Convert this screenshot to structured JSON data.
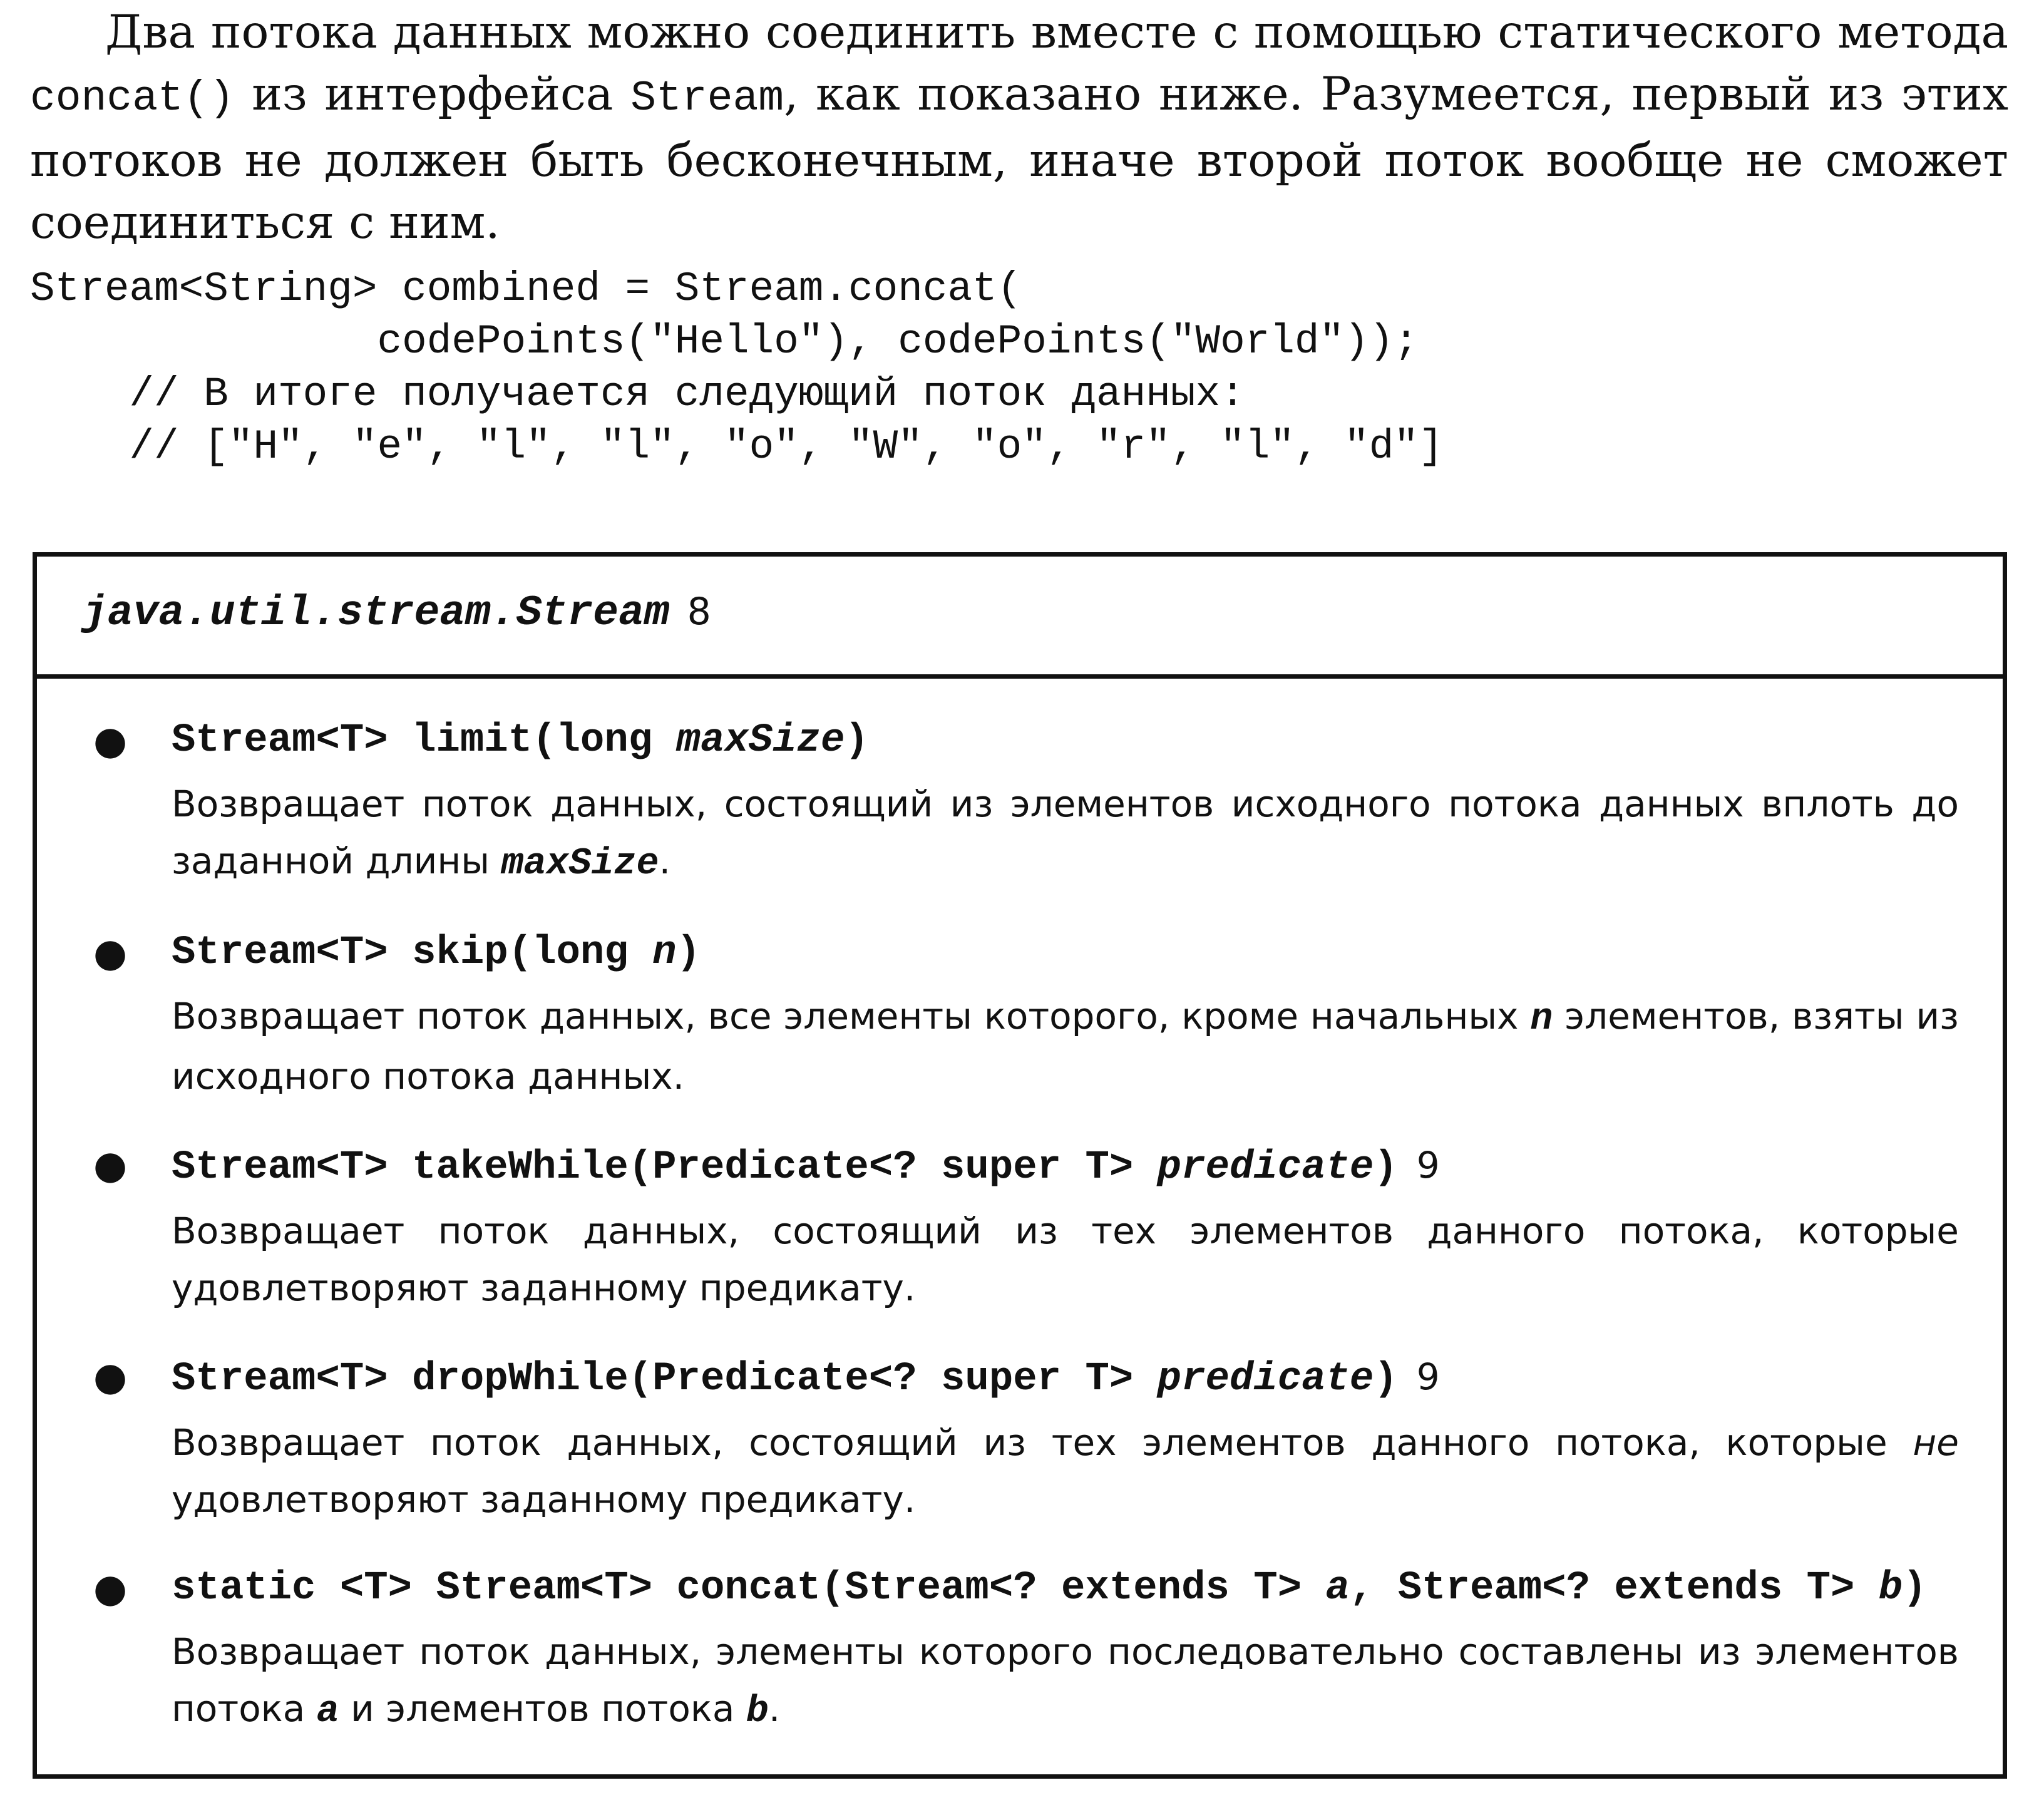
{
  "paragraph": {
    "part1": "Два потока данных можно соединить вместе с помощью статического метода ",
    "method_concat": "concat()",
    "part2": " из интерфейса ",
    "iface_stream": "Stream",
    "part3": ", как показано ниже. Разумеется, первый из этих потоков не должен быть бесконечным, иначе второй поток вообще не сможет соединиться с ним."
  },
  "code_lines": [
    "Stream<String> combined = Stream.concat(",
    "              codePoints(\"Hello\"), codePoints(\"World\"));",
    "    // В итоге получается следующий поток данных:",
    "    // [\"H\", \"e\", \"l\", \"l\", \"o\", \"W\", \"o\", \"r\", \"l\", \"d\"]"
  ],
  "api_box": {
    "title": "java.util.stream.Stream",
    "version": "8",
    "entries": [
      {
        "sig_pre": "Stream<T> limit(long ",
        "sig_param": "maxSize",
        "sig_post": ")",
        "sig_version": "",
        "desc_pre": "Возвращает поток данных, состоящий из элементов исходного потока данных вплоть до заданной длины ",
        "desc_param": "maxSize",
        "desc_post": "."
      },
      {
        "sig_pre": "Stream<T> skip(long ",
        "sig_param": "n",
        "sig_post": ")",
        "sig_version": "",
        "desc_pre": "Возвращает поток данных, все элементы которого, кроме начальных ",
        "desc_param": "n",
        "desc_post": " элементов, взяты из исходного потока данных."
      },
      {
        "sig_pre": "Stream<T> takeWhile(Predicate<? super T> ",
        "sig_param": "predicate",
        "sig_post": ")",
        "sig_version": "9",
        "desc_pre": "Возвращает поток данных, состоящий из тех элементов данного потока, которые удовлетворяют заданному предикату.",
        "desc_param": "",
        "desc_post": ""
      },
      {
        "sig_pre": "Stream<T> dropWhile(Predicate<? super T> ",
        "sig_param": "predicate",
        "sig_post": ")",
        "sig_version": "9",
        "desc_pre": "Возвращает поток данных, состоящий из тех элементов данного потока, которые ",
        "desc_em": "не",
        "desc_post": " удовлетворяют заданному предикату."
      },
      {
        "sig_pre": "static <T> Stream<T> concat(Stream<? extends T> ",
        "sig_param": "a",
        "sig_mid": ", Stream<? extends T> ",
        "sig_param2": "b",
        "sig_post": ")",
        "desc_pre": "Возвращает поток данных, элементы которого последовательно составлены из элементов потока ",
        "desc_param": "a",
        "desc_mid": " и элементов потока ",
        "desc_param2": "b",
        "desc_post": "."
      }
    ]
  }
}
